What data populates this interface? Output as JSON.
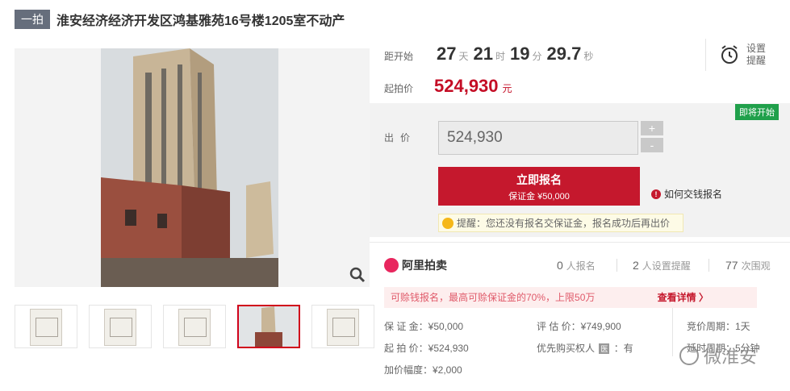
{
  "title": {
    "badge": "一拍",
    "text": "淮安经济经济开发区鸿基雅苑16号楼1205室不动产"
  },
  "countdown": {
    "label": "距开始",
    "days": "27",
    "days_unit": "天",
    "hours": "21",
    "hours_unit": "时",
    "minutes": "19",
    "minutes_unit": "分",
    "seconds": "29.7",
    "seconds_unit": "秒"
  },
  "reminder": {
    "label": "设置提醒",
    "icon": "alarm-clock-icon"
  },
  "start_price": {
    "label": "起拍价",
    "value": "524,930",
    "unit": "元"
  },
  "bid": {
    "status_tag": "即将开始",
    "label": "出价",
    "input_value": "524,930",
    "plus": "+",
    "minus": "-",
    "register_main": "立即报名",
    "register_sub": "保证金 ¥50,000",
    "howto": "如何交钱报名",
    "tip": "提醒：您还没有报名交保证金，报名成功后再出价"
  },
  "stats": {
    "brand": "阿里拍卖",
    "registrations_value": "0",
    "registrations_label": "人报名",
    "reminders_value": "2",
    "reminders_label": "人设置提醒",
    "views_value": "77",
    "views_label": "次围观"
  },
  "deposit_note": {
    "text": "可赊钱报名，最高可赊保证金的70%，上限50万",
    "link": "查看详情 〉"
  },
  "info": {
    "deposit": "保 证 金：¥50,000",
    "start": "起 拍 价：¥524,930",
    "increment": "加价幅度：¥2,000",
    "appraisal": "评 估 价：¥749,900",
    "priority": "优先购买权人",
    "priority_badge": "医",
    "priority_value": "：有",
    "cycle": "竞价周期：1天",
    "extension": "延时周期：5分钟"
  },
  "watermark": "微淮安",
  "colors": {
    "accent_red": "#c5182d",
    "price_red": "#c40d25",
    "green_tag": "#20a04b"
  }
}
